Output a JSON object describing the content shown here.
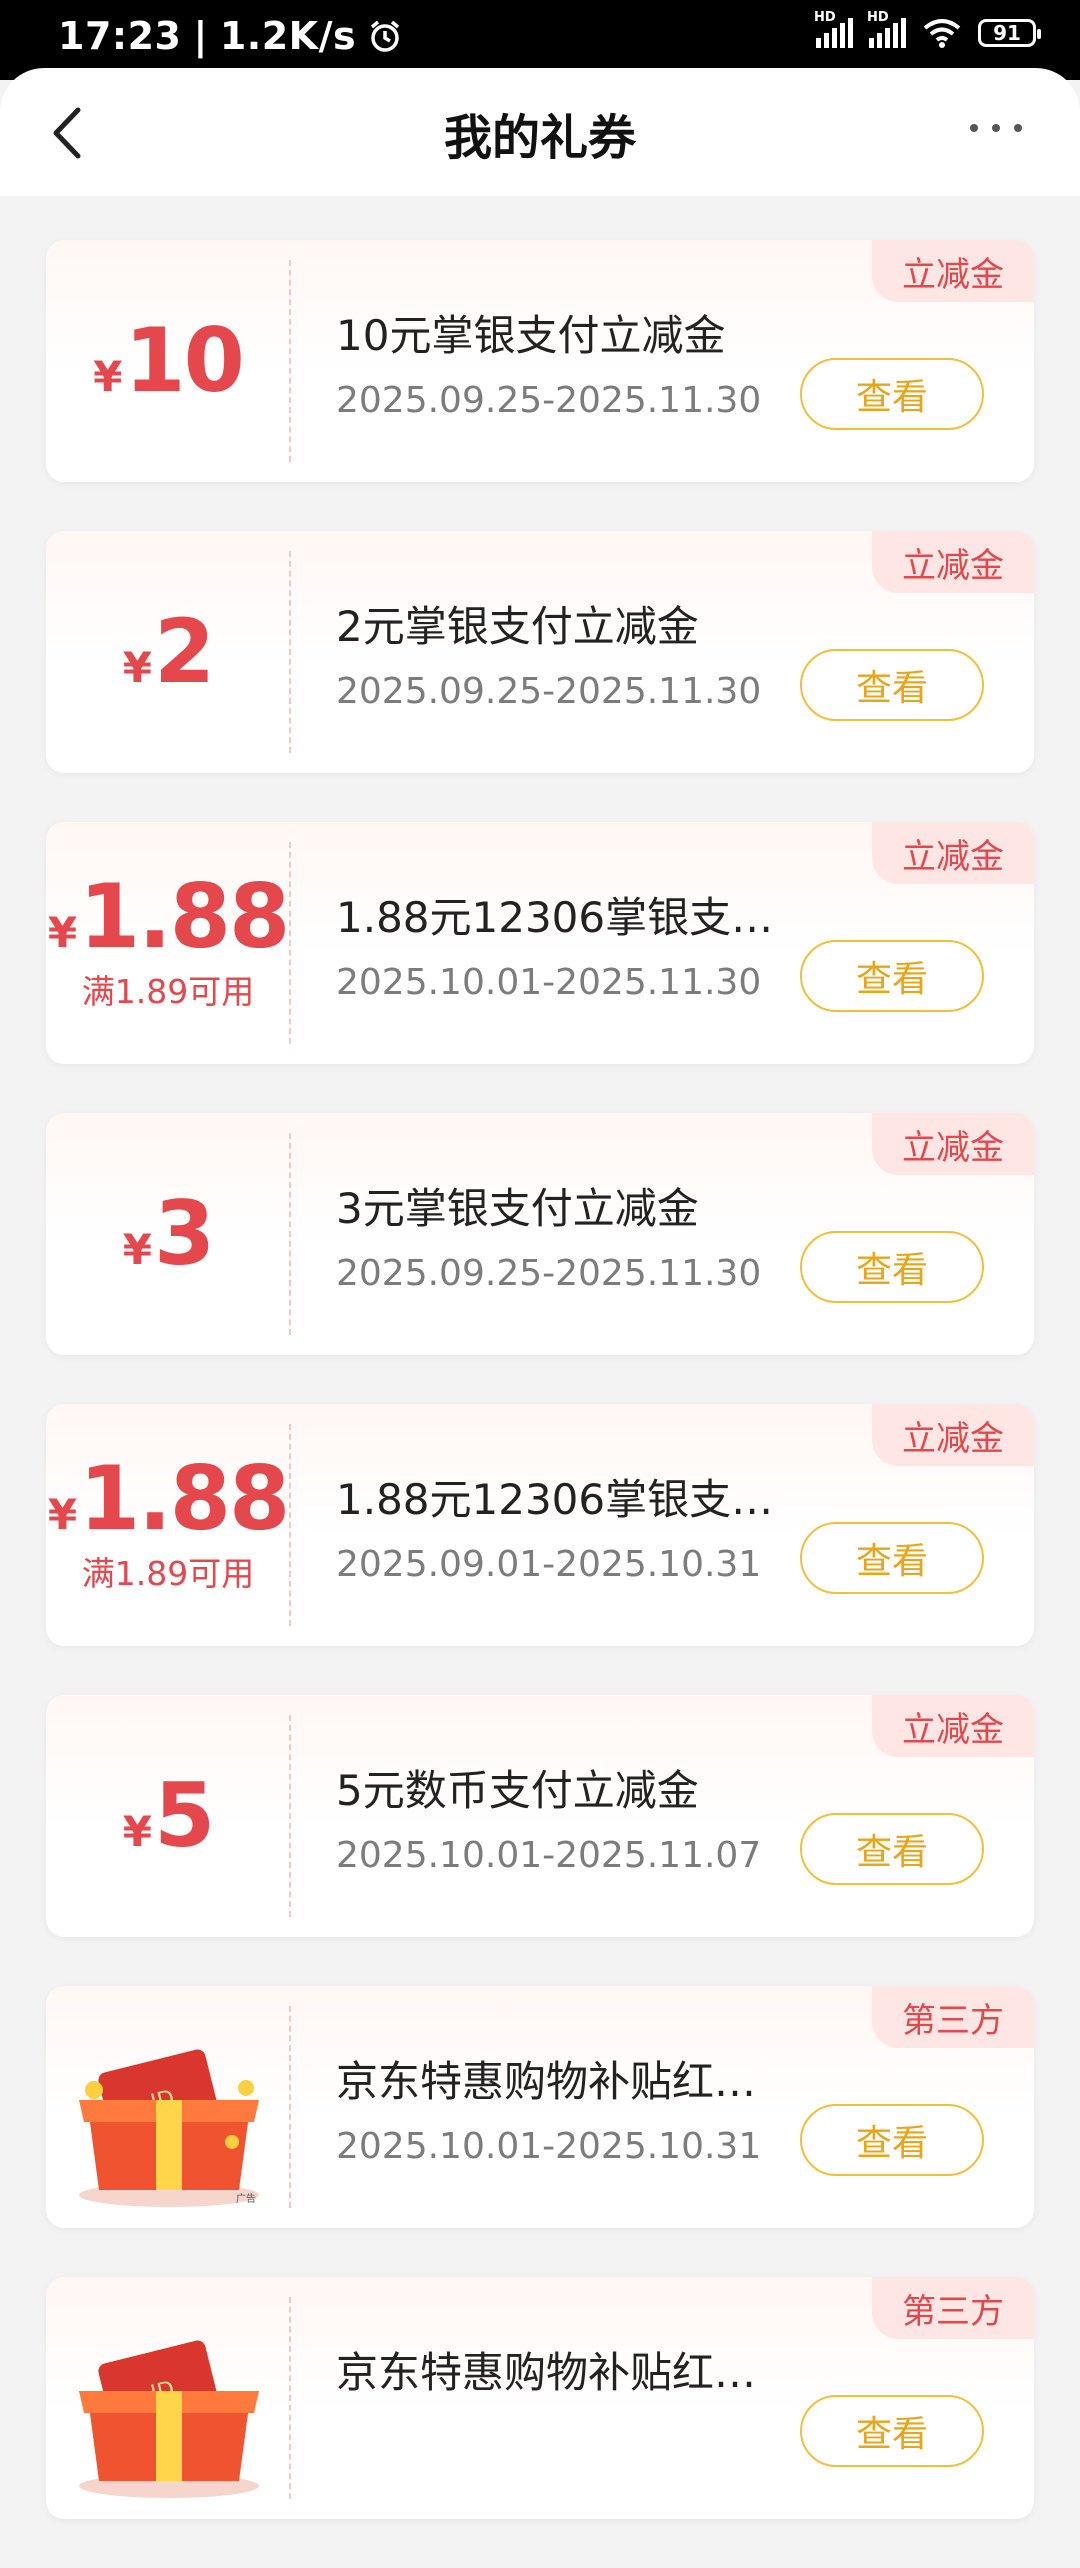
{
  "status": {
    "time": "17:23",
    "speed": "1.2K/s",
    "hd1": "HD",
    "hd2": "HD",
    "battery": "91"
  },
  "header": {
    "title": "我的礼券"
  },
  "coupons": [
    {
      "tag": "立减金",
      "symbol": "¥",
      "amount": "10",
      "condition": "",
      "name": "10元掌银支付立减金",
      "date": "2025.09.25-2025.11.30",
      "button": "查看"
    },
    {
      "tag": "立减金",
      "symbol": "¥",
      "amount": "2",
      "condition": "",
      "name": "2元掌银支付立减金",
      "date": "2025.09.25-2025.11.30",
      "button": "查看"
    },
    {
      "tag": "立减金",
      "symbol": "¥",
      "amount": "1.88",
      "condition": "满1.89可用",
      "name": "1.88元12306掌银支…",
      "date": "2025.10.01-2025.11.30",
      "button": "查看"
    },
    {
      "tag": "立减金",
      "symbol": "¥",
      "amount": "3",
      "condition": "",
      "name": "3元掌银支付立减金",
      "date": "2025.09.25-2025.11.30",
      "button": "查看"
    },
    {
      "tag": "立减金",
      "symbol": "¥",
      "amount": "1.88",
      "condition": "满1.89可用",
      "name": "1.88元12306掌银支…",
      "date": "2025.09.01-2025.10.31",
      "button": "查看"
    },
    {
      "tag": "立减金",
      "symbol": "¥",
      "amount": "5",
      "condition": "",
      "name": "5元数币支付立减金",
      "date": "2025.10.01-2025.11.07",
      "button": "查看"
    },
    {
      "tag": "第三方",
      "name": "京东特惠购物补贴红…",
      "date": "2025.10.01-2025.10.31",
      "button": "查看",
      "ad": "广告"
    },
    {
      "tag": "第三方",
      "name": "京东特惠购物补贴红…",
      "date": "",
      "button": "查看"
    }
  ]
}
